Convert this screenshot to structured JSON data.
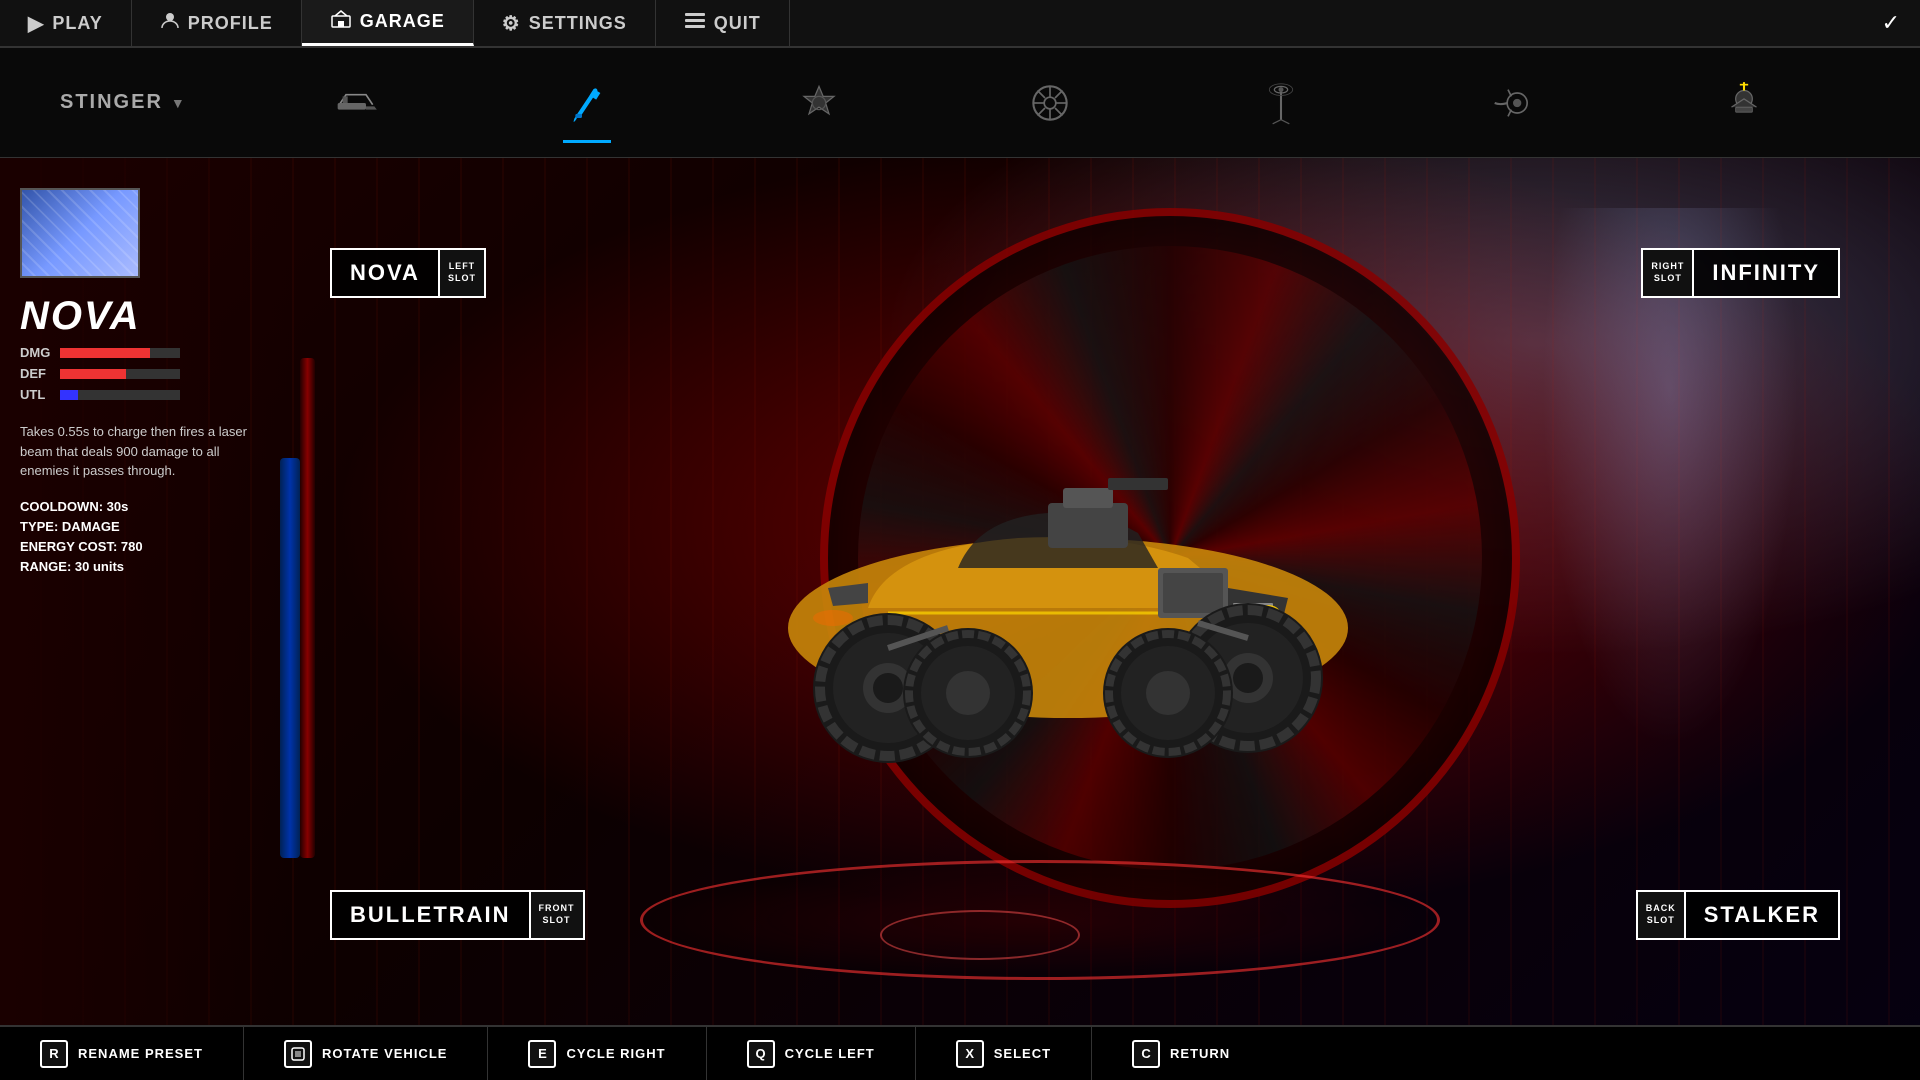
{
  "nav": {
    "items": [
      {
        "id": "play",
        "label": "PLAY",
        "icon": "▶",
        "active": false
      },
      {
        "id": "profile",
        "label": "PROFILE",
        "icon": "👤",
        "active": false
      },
      {
        "id": "garage",
        "label": "GARAGE",
        "icon": "🏎",
        "active": true
      },
      {
        "id": "settings",
        "label": "SETTINGS",
        "icon": "⚙",
        "active": false
      },
      {
        "id": "quit",
        "label": "QUIT",
        "icon": "🚪",
        "active": false
      }
    ]
  },
  "toolbar": {
    "preset_name": "STINGER",
    "icons": [
      {
        "id": "gun",
        "active": false
      },
      {
        "id": "paint",
        "active": true
      },
      {
        "id": "emblem",
        "active": false
      },
      {
        "id": "wheel",
        "active": false
      },
      {
        "id": "antenna",
        "active": false
      },
      {
        "id": "boost",
        "active": false
      },
      {
        "id": "topper",
        "active": false
      }
    ]
  },
  "weapon_panel": {
    "name": "NOVA",
    "stat_dmg": 75,
    "stat_def": 55,
    "stat_utl": 15,
    "description": "Takes 0.55s to charge then fires a laser beam that deals 900 damage to all enemies it passes through.",
    "cooldown": "30s",
    "type": "DAMAGE",
    "energy_cost": "780",
    "range": "30 units",
    "stats_labels": {
      "dmg": "DMG",
      "def": "DEF",
      "utl": "UTL",
      "cooldown": "COOLDOWN:",
      "type": "TYPE:",
      "energy": "ENERGY COST:",
      "range": "RANGE:"
    }
  },
  "slots": {
    "left": {
      "weapon": "NOVA",
      "slot_line1": "LEFT",
      "slot_line2": "SLOT"
    },
    "right": {
      "weapon": "INFINITY",
      "slot_line1": "RIGHT",
      "slot_line2": "SLOT"
    },
    "front": {
      "weapon": "BULLETRAIN",
      "slot_line1": "FRONT",
      "slot_line2": "SLOT"
    },
    "back": {
      "weapon": "STALKER",
      "slot_line1": "BACK",
      "slot_line2": "SLOT"
    }
  },
  "bottom_bar": {
    "actions": [
      {
        "key": "R",
        "label": "RENAME PRESET"
      },
      {
        "key": "▣",
        "label": "ROTATE VEHICLE"
      },
      {
        "key": "E",
        "label": "CYCLE RIGHT"
      },
      {
        "key": "Q",
        "label": "CYCLE LEFT"
      },
      {
        "key": "X",
        "label": "SELECT"
      },
      {
        "key": "C",
        "label": "RETURN"
      }
    ]
  },
  "colors": {
    "accent_red": "#cc2200",
    "accent_blue": "#0077ff",
    "nav_bg": "#111111",
    "panel_bg": "rgba(0,0,0,0.85)",
    "bar_dmg": "#dd3333",
    "bar_utl": "#3333ff"
  }
}
